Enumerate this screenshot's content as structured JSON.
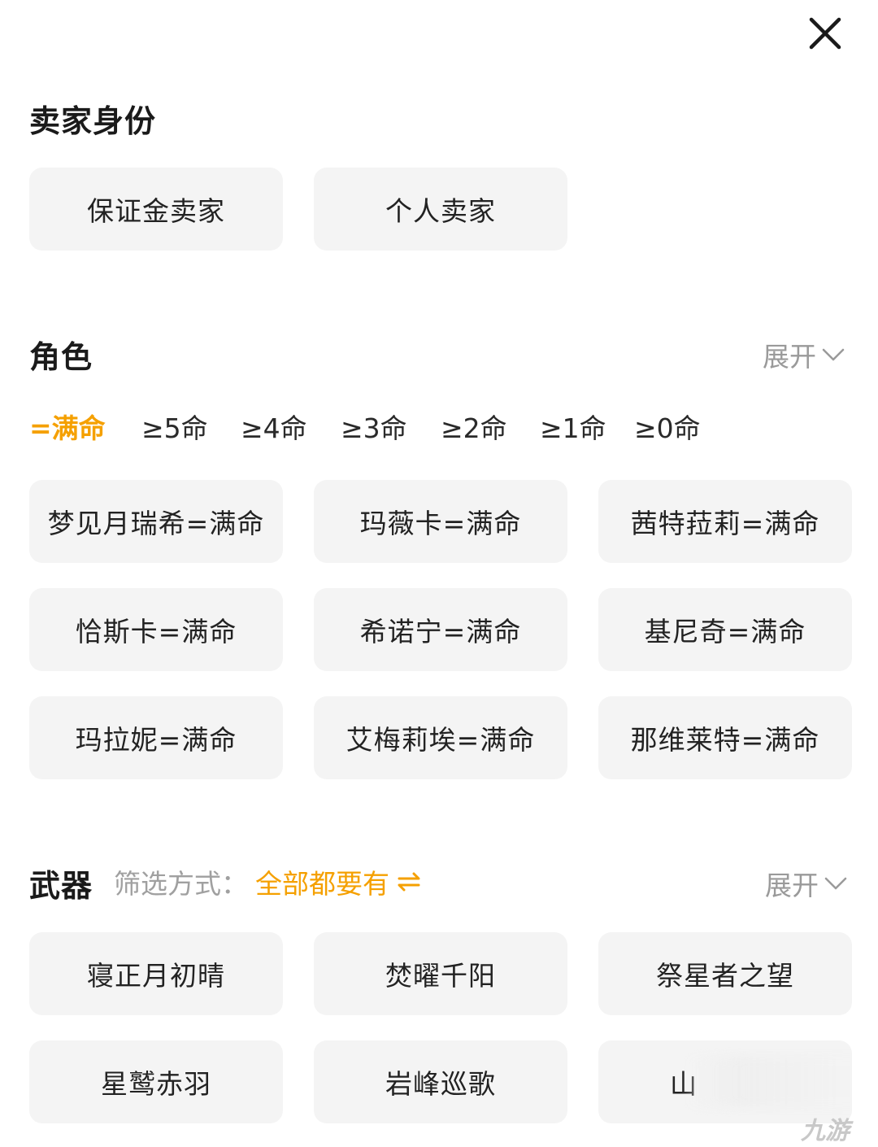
{
  "seller_section": {
    "title": "卖家身份",
    "options": [
      "保证金卖家",
      "个人卖家"
    ]
  },
  "character_section": {
    "title": "角色",
    "expand_label": "展开",
    "levels": [
      "=满命",
      "≥5命",
      "≥4命",
      "≥3命",
      "≥2命",
      "≥1命",
      "≥0命"
    ],
    "active_level": "=满命",
    "chips": [
      "梦见月瑞希=满命",
      "玛薇卡=满命",
      "茜特菈莉=满命",
      "恰斯卡=满命",
      "希诺宁=满命",
      "基尼奇=满命",
      "玛拉妮=满命",
      "艾梅莉埃=满命",
      "那维莱特=满命"
    ]
  },
  "weapon_section": {
    "title": "武器",
    "filter_label": "筛选方式：",
    "filter_value": "全部都要有",
    "expand_label": "展开",
    "chips": [
      "寝正月初晴",
      "焚曜千阳",
      "祭星者之望",
      "星鹫赤羽",
      "岩峰巡歌",
      "山"
    ]
  },
  "watermark": "九游",
  "colors": {
    "accent": "#f5a000",
    "chip_bg": "#f4f4f4",
    "muted": "#9a9a9a"
  }
}
